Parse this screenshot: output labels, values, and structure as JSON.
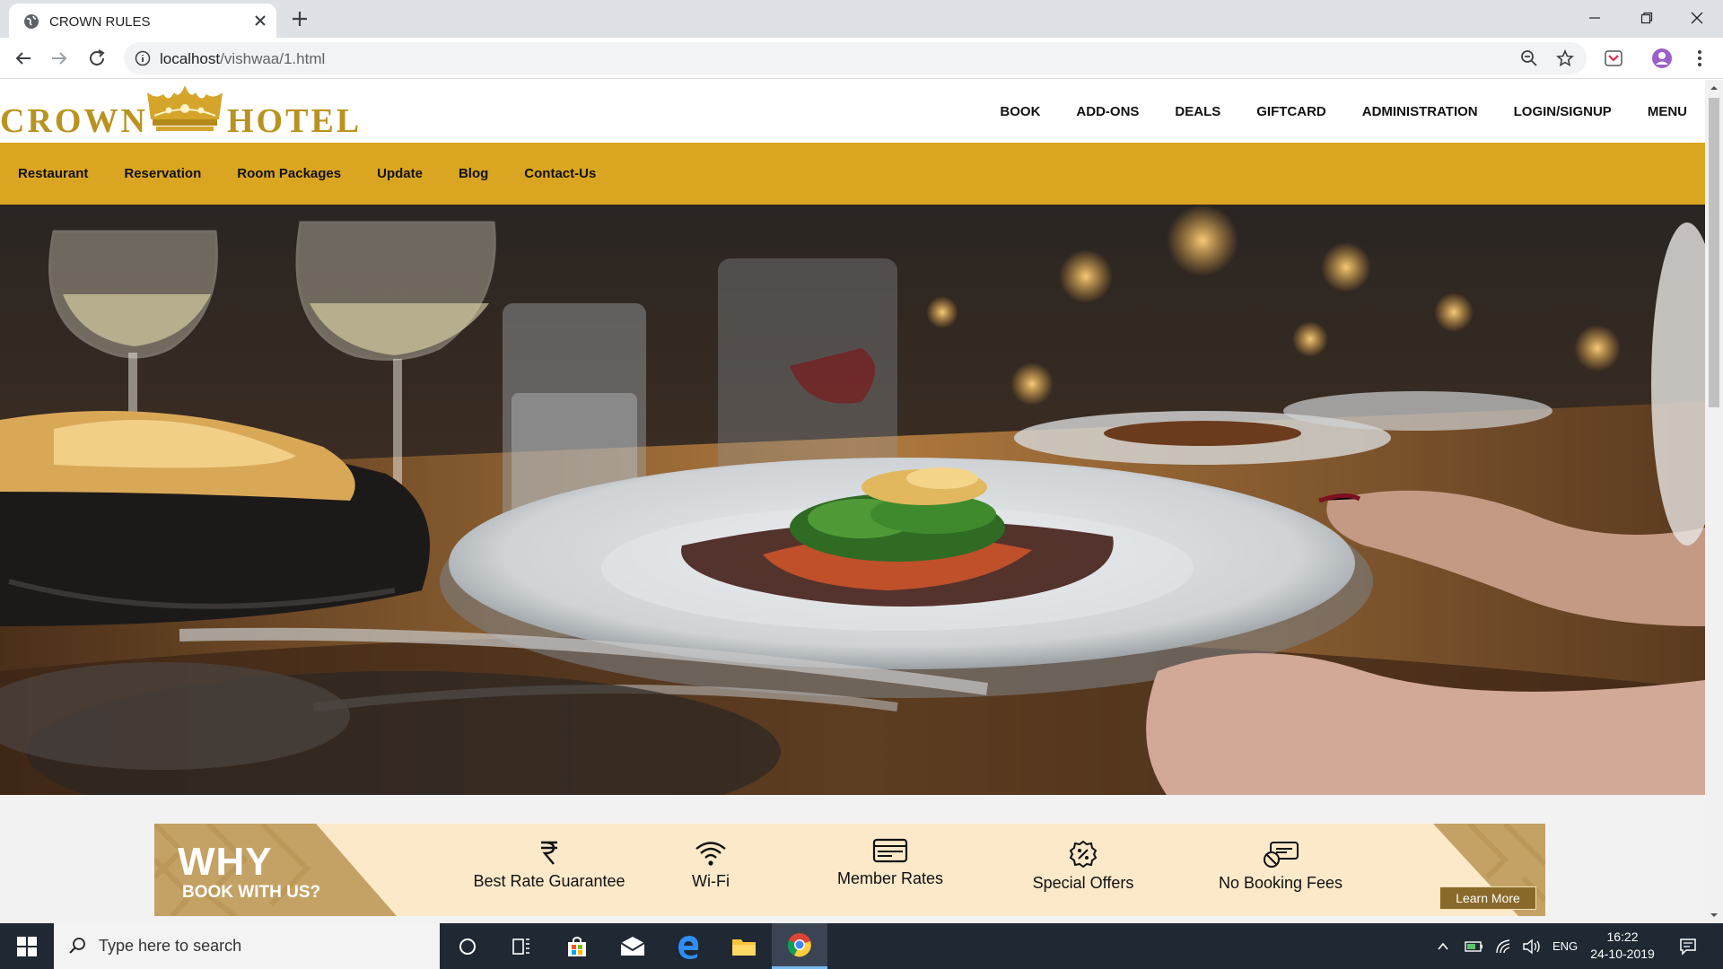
{
  "browser": {
    "tab_title": "CROWN RULES",
    "url_host": "localhost",
    "url_path": "/vishwaa/1.html"
  },
  "site": {
    "logo_left": "CROWN",
    "logo_right": "HOTEL",
    "main_nav": [
      "BOOK",
      "ADD-ONS",
      "DEALS",
      "GIFTCARD",
      "ADMINISTRATION",
      "LOGIN/SIGNUP",
      "MENU"
    ],
    "sub_nav": [
      "Restaurant",
      "Reservation",
      "Room Packages",
      "Update",
      "Blog",
      "Contact-Us"
    ],
    "accent_color": "#daa520"
  },
  "why": {
    "title": "WHY",
    "subtitle": "BOOK WITH US?",
    "features": [
      {
        "label": "Best Rate Guarantee",
        "icon": "rupee-icon"
      },
      {
        "label": "Wi-Fi",
        "icon": "wifi-icon"
      },
      {
        "label": "Member Rates",
        "icon": "card-icon"
      },
      {
        "label": "Special Offers",
        "icon": "discount-badge-icon"
      },
      {
        "label": "No Booking Fees",
        "icon": "no-fee-ticket-icon"
      }
    ],
    "cta": "Learn More"
  },
  "taskbar": {
    "search_placeholder": "Type here to search",
    "language": "ENG",
    "time": "16:22",
    "date": "24-10-2019"
  }
}
